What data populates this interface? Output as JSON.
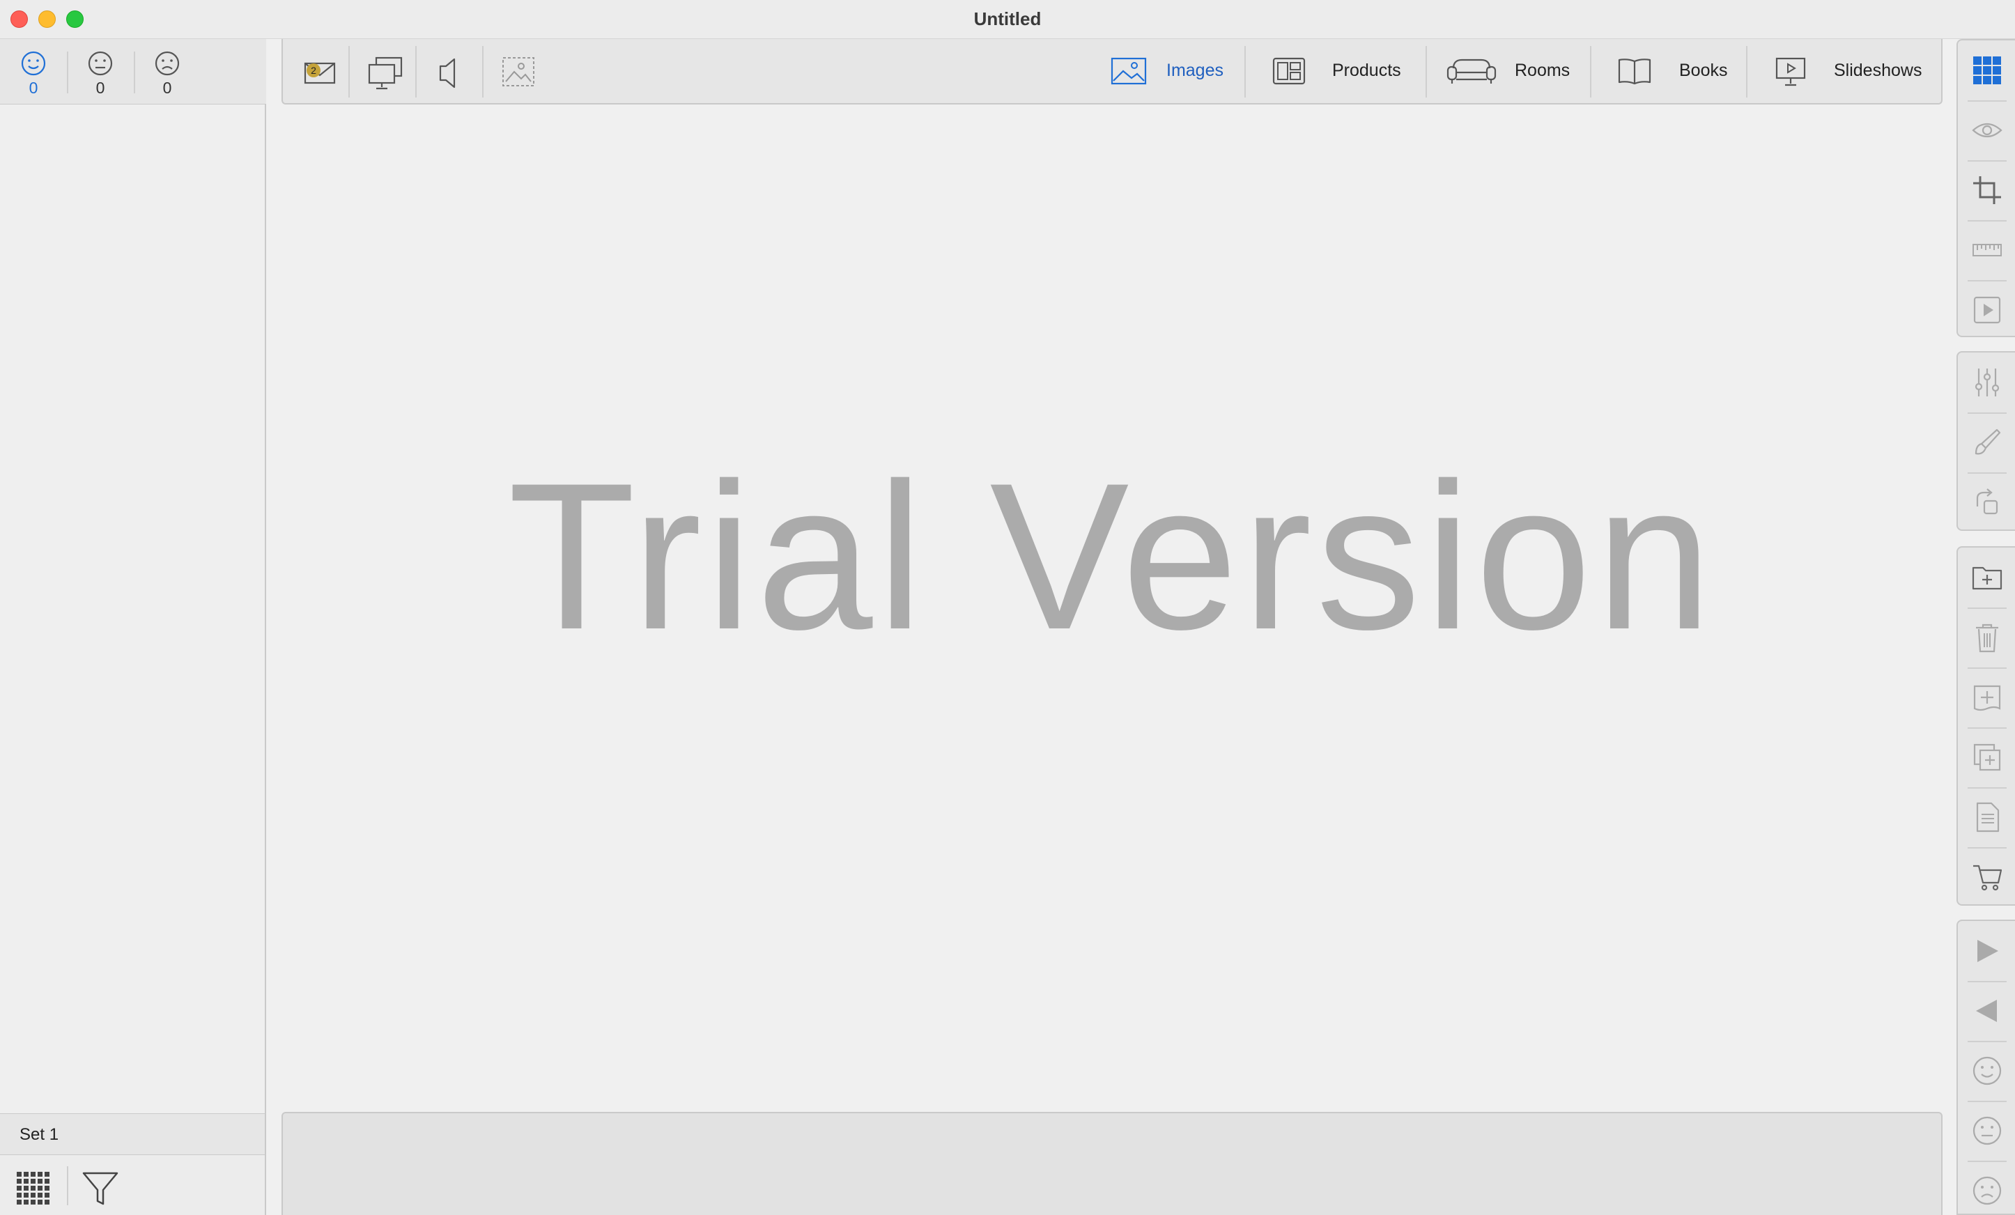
{
  "window": {
    "title": "Untitled"
  },
  "sidebar": {
    "ratings": [
      {
        "name": "happy",
        "count": "0",
        "active": true
      },
      {
        "name": "neutral",
        "count": "0",
        "active": false
      },
      {
        "name": "sad",
        "count": "0",
        "active": false
      }
    ],
    "set_label": "Set 1"
  },
  "toolbar": {
    "mail_badge": "2",
    "nav": [
      {
        "label": "Images",
        "icon": "image-icon",
        "active": true
      },
      {
        "label": "Products",
        "icon": "products-icon",
        "active": false
      },
      {
        "label": "Rooms",
        "icon": "sofa-icon",
        "active": false
      },
      {
        "label": "Books",
        "icon": "book-icon",
        "active": false
      },
      {
        "label": "Slideshows",
        "icon": "presentation-icon",
        "active": false
      }
    ]
  },
  "main": {
    "watermark": "Trial Version"
  },
  "colors": {
    "accent": "#1f6fd6",
    "watermark": "#ababab",
    "badge": "#c5a33a"
  }
}
